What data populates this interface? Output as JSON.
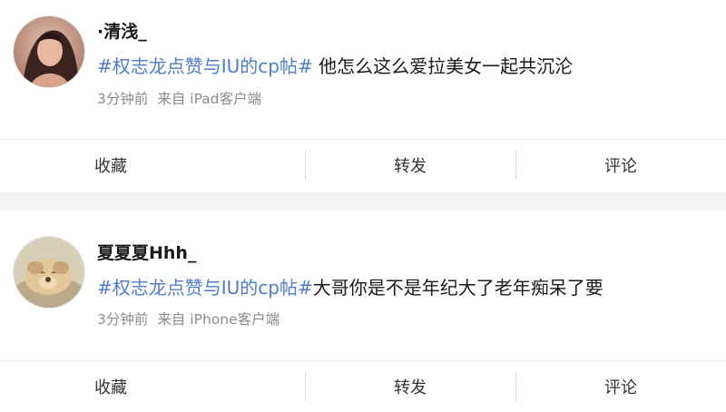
{
  "posts": [
    {
      "username": "·清浅_",
      "hashtag": "#权志龙点赞与IU的cp帖#",
      "text": " 他怎么这么爱拉美女一起共沉沦",
      "time": "3分钟前",
      "source": "来自 iPad客户端",
      "actions": {
        "favorite": "收藏",
        "repost": "转发",
        "comment": "评论"
      }
    },
    {
      "username": "夏夏夏Hhh_",
      "hashtag": "#权志龙点赞与IU的cp帖#",
      "text": "大哥你是不是年纪大了老年痴呆了要",
      "time": "3分钟前",
      "source": "来自 iPhone客户端",
      "actions": {
        "favorite": "收藏",
        "repost": "转发",
        "comment": "评论"
      }
    }
  ],
  "colors": {
    "hashtag": "#4f7cc7",
    "meta": "#8a8a8a",
    "divider": "#ececec",
    "background": "#f4f4f4"
  }
}
